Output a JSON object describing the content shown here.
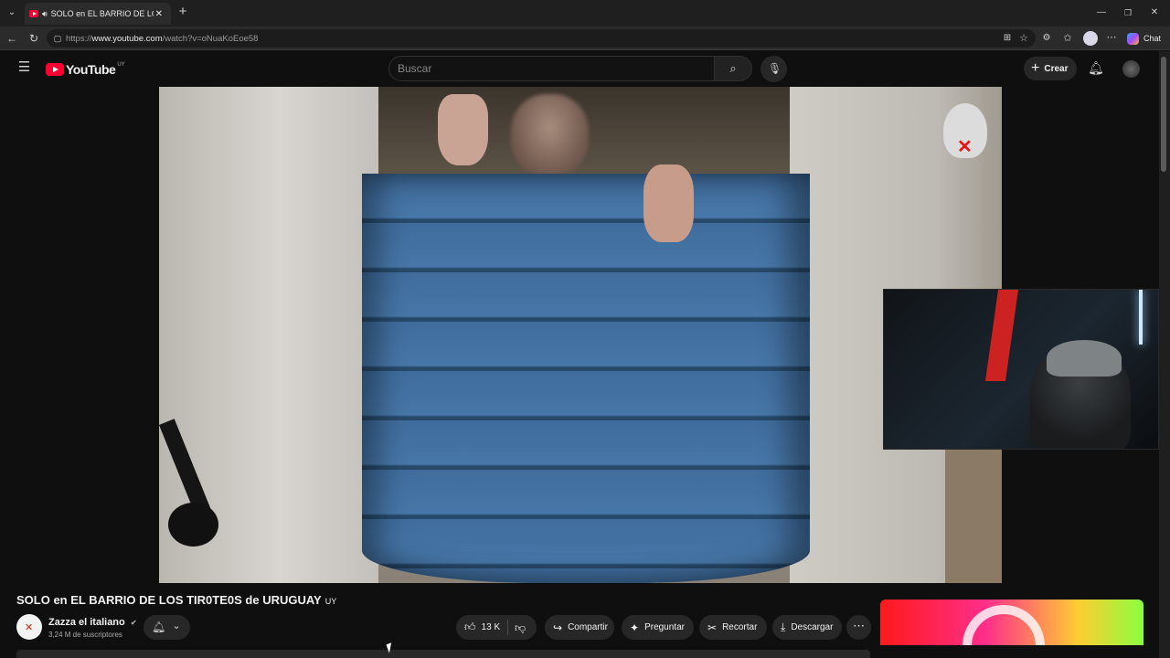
{
  "browser": {
    "tab_title": "SOLO en EL BARRIO DE LOS TI",
    "url_prefix": "https://",
    "url_host": "www.youtube.com",
    "url_path": "/watch?v=oNuaKoEoe58",
    "chat_label": "Chat"
  },
  "youtube": {
    "logo_text": "YouTube",
    "region": "UY",
    "search_placeholder": "Buscar",
    "create_label": "Crear"
  },
  "video": {
    "title": "SOLO en EL BARRIO DE LOS TIR0TE0S de URUGUAY",
    "title_suffix": "UY",
    "channel_name": "Zazza el italiano",
    "subscribers": "3,24 M de suscriptores",
    "likes": "13 K",
    "actions": {
      "share": "Compartir",
      "ask": "Preguntar",
      "clip": "Recortar",
      "download": "Descargar"
    }
  },
  "icons": {
    "tab_list": "chevron-down-icon",
    "audio": "speaker-icon",
    "close_tab": "close-icon",
    "new_tab": "plus-icon",
    "back": "arrow-left-icon",
    "reload": "reload-icon",
    "site_info": "site-info-icon",
    "menu": "hamburger-icon",
    "search": "search-icon",
    "mic": "microphone-icon",
    "bell": "bell-icon",
    "like": "thumbs-up-icon",
    "dislike": "thumbs-down-icon",
    "verified": "verified-icon"
  },
  "colors": {
    "youtube_red": "#ff0033",
    "background": "#0f0f0f",
    "pill": "#272727"
  }
}
